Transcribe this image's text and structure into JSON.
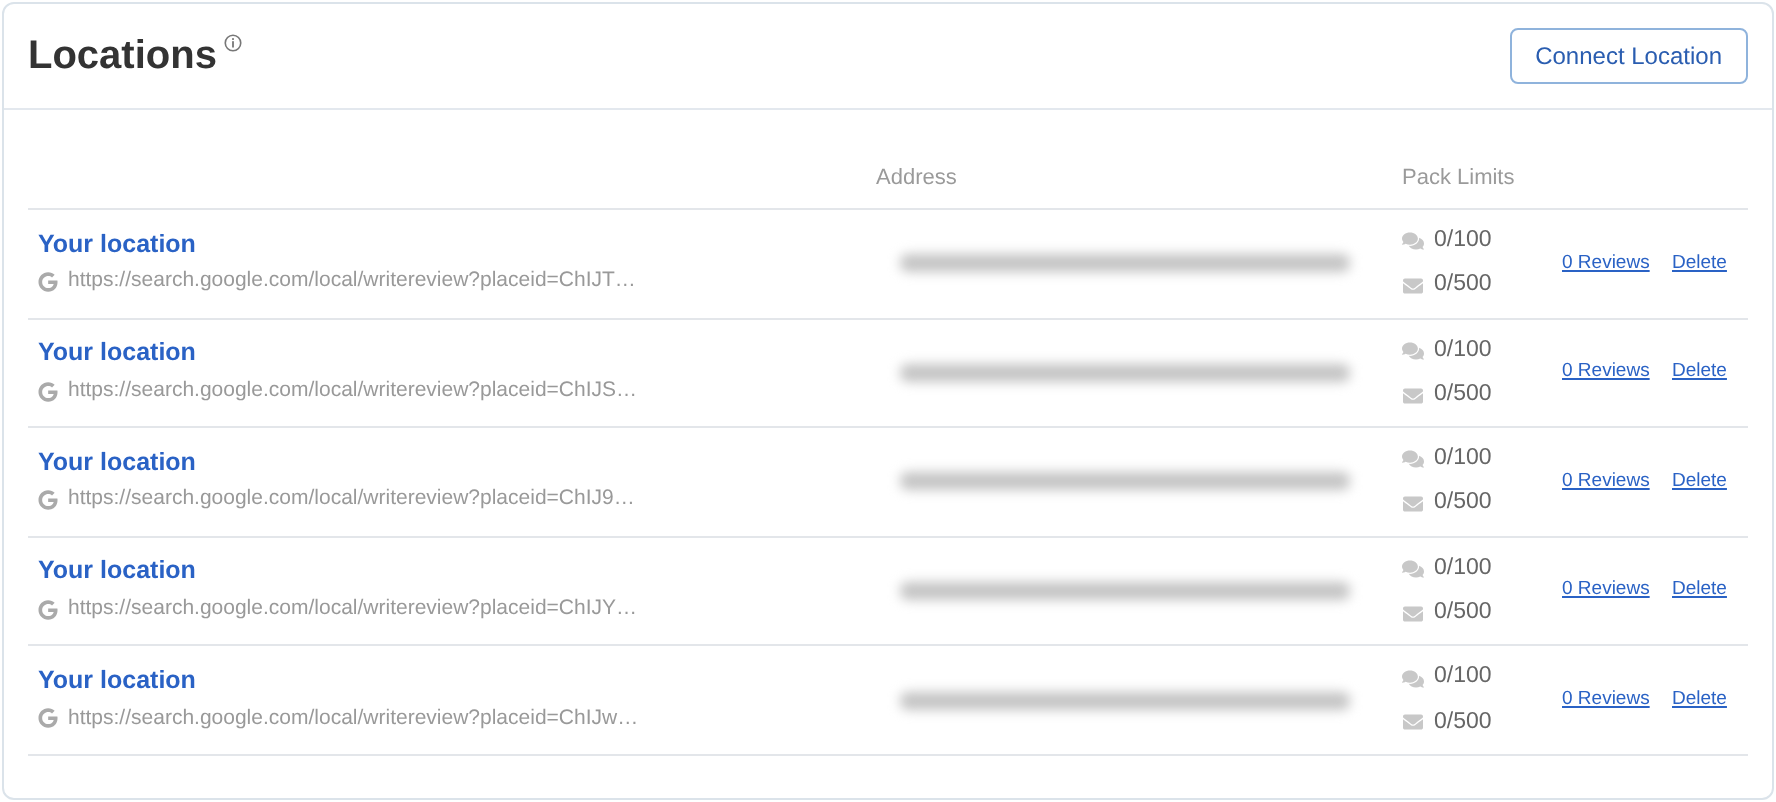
{
  "header": {
    "title": "Locations",
    "button": "Connect Location"
  },
  "table": {
    "columns": [
      "Address",
      "Pack Limits"
    ],
    "rows": [
      {
        "name": "Your location",
        "url": "https://search.google.com/local/writereview?placeid=ChIJT…",
        "messages": "0/100",
        "emails": "0/500",
        "reviews": "0 Reviews",
        "delete": "Delete"
      },
      {
        "name": "Your location",
        "url": "https://search.google.com/local/writereview?placeid=ChIJS…",
        "messages": "0/100",
        "emails": "0/500",
        "reviews": "0 Reviews",
        "delete": "Delete"
      },
      {
        "name": "Your location",
        "url": "https://search.google.com/local/writereview?placeid=ChIJ9…",
        "messages": "0/100",
        "emails": "0/500",
        "reviews": "0 Reviews",
        "delete": "Delete"
      },
      {
        "name": "Your location",
        "url": "https://search.google.com/local/writereview?placeid=ChIJY…",
        "messages": "0/100",
        "emails": "0/500",
        "reviews": "0 Reviews",
        "delete": "Delete"
      },
      {
        "name": "Your location",
        "url": "https://search.google.com/local/writereview?placeid=ChIJw…",
        "messages": "0/100",
        "emails": "0/500",
        "reviews": "0 Reviews",
        "delete": "Delete"
      }
    ]
  }
}
